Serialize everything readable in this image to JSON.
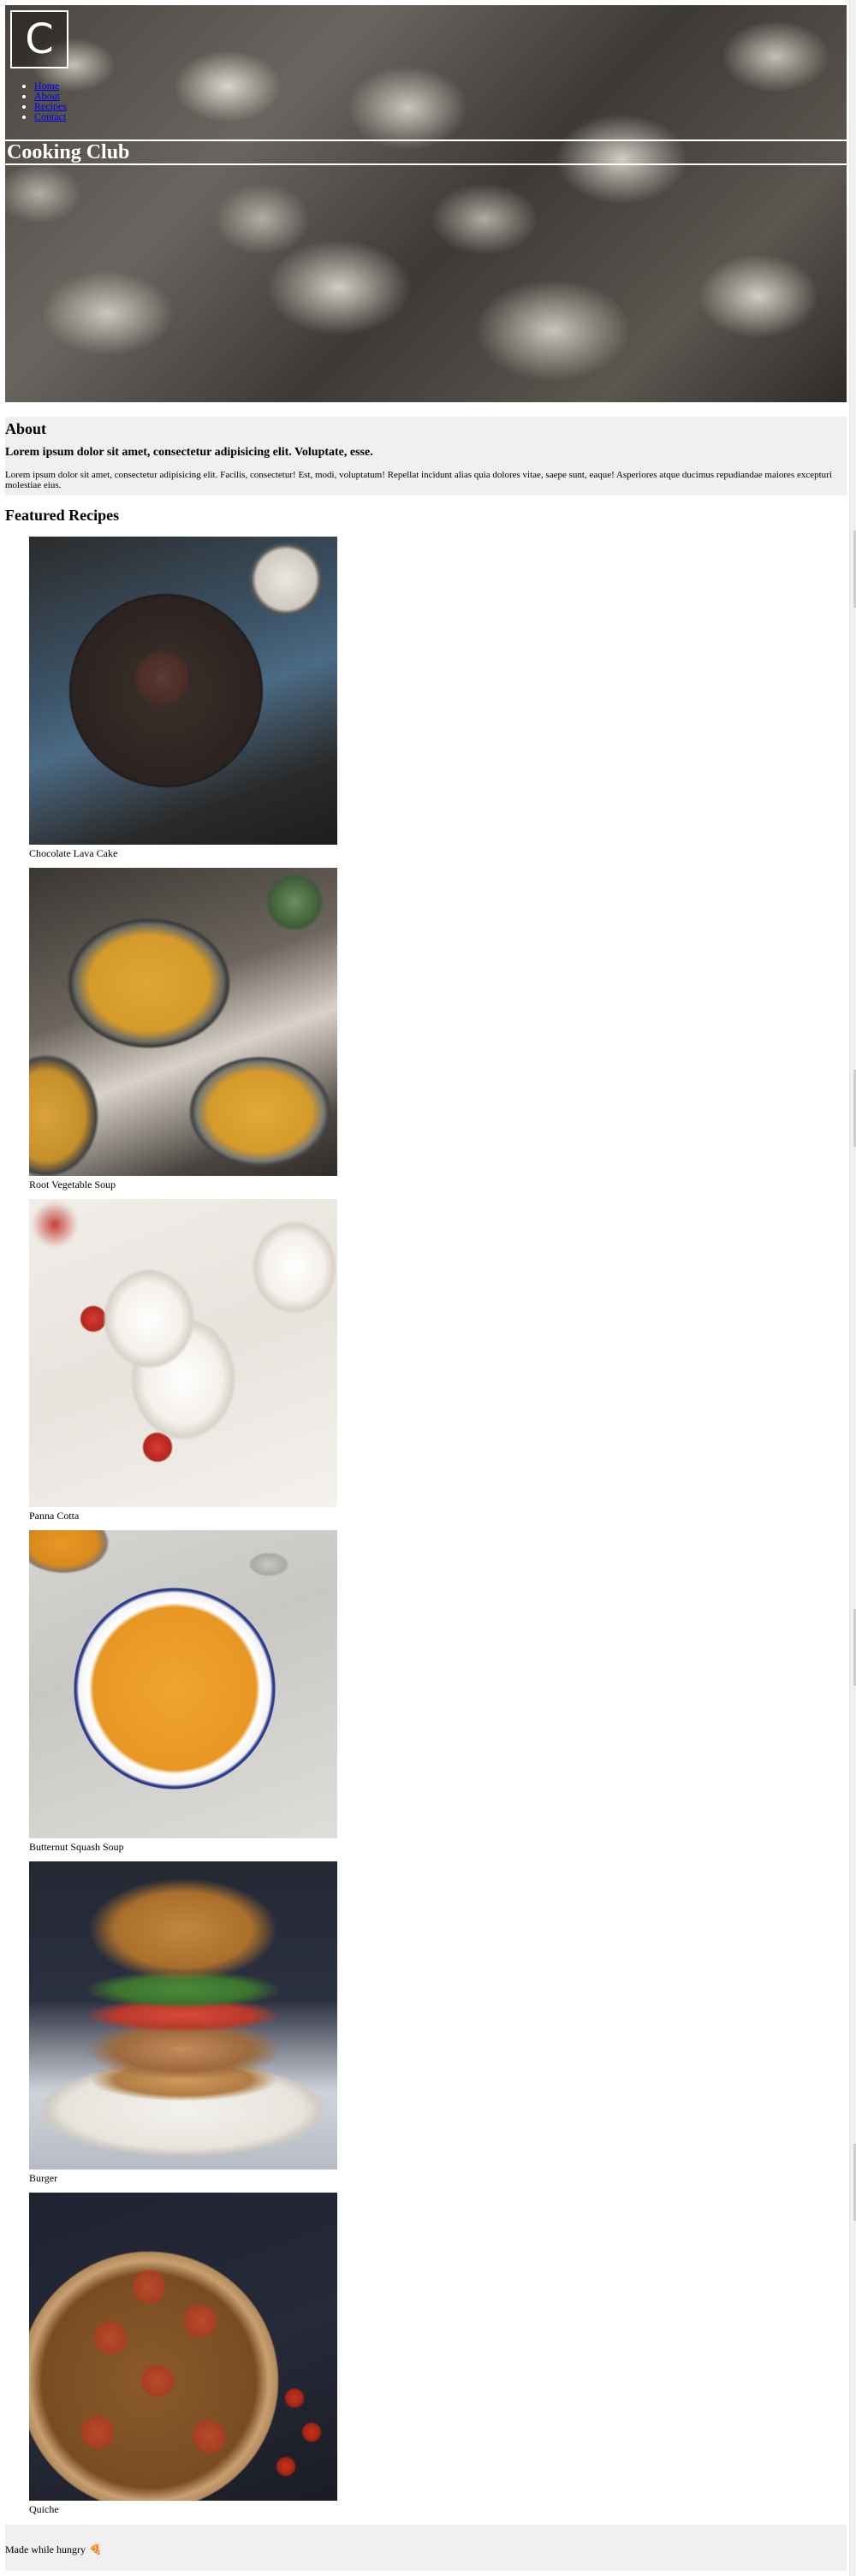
{
  "header": {
    "logo_letter": "C",
    "nav": [
      {
        "label": "Home"
      },
      {
        "label": "About"
      },
      {
        "label": "Recipes"
      },
      {
        "label": "Contact"
      }
    ],
    "title": "Cooking Club"
  },
  "about": {
    "heading": "About",
    "subheading": "Lorem ipsum dolor sit amet, consectetur adipisicing elit. Voluptate, esse.",
    "body": "Lorem ipsum dolor sit amet, consectetur adipisicing elit. Facilis, consectetur! Est, modi, voluptatum! Repellat incidunt alias quia dolores vitae, saepe sunt, eaque! Asperiores atque ducimus repudiandae maiores excepturi molestiae eius."
  },
  "recipes": {
    "heading": "Featured Recipes",
    "items": [
      {
        "name": "Chocolate Lava Cake"
      },
      {
        "name": "Root Vegetable Soup"
      },
      {
        "name": "Panna Cotta"
      },
      {
        "name": "Butternut Squash Soup"
      },
      {
        "name": "Burger"
      },
      {
        "name": "Quiche"
      }
    ]
  },
  "footer": {
    "text": "Made while hungry",
    "icon": "🍕",
    "icon_name": "pizza-icon"
  }
}
